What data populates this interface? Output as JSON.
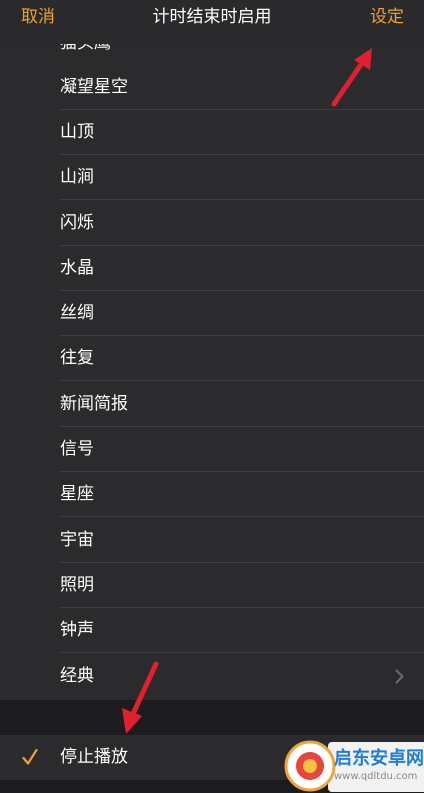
{
  "nav": {
    "cancel_label": "取消",
    "title": "计时结束时启用",
    "set_label": "设定"
  },
  "list": {
    "partial_item": "猫头鹰",
    "items": [
      "凝望星空",
      "山顶",
      "山涧",
      "闪烁",
      "水晶",
      "丝绸",
      "往复",
      "新闻简报",
      "信号",
      "星座",
      "宇宙",
      "照明",
      "钟声",
      "经典"
    ]
  },
  "stop": {
    "label": "停止播放",
    "checked": true
  },
  "colors": {
    "accent": "#f0a02e",
    "background": "#1c1c1e",
    "row_background": "#2b2b2d",
    "annotation_arrow": "#e0202e"
  },
  "watermark": {
    "title": "启东安卓网",
    "url": "www.qdltdu.com"
  }
}
